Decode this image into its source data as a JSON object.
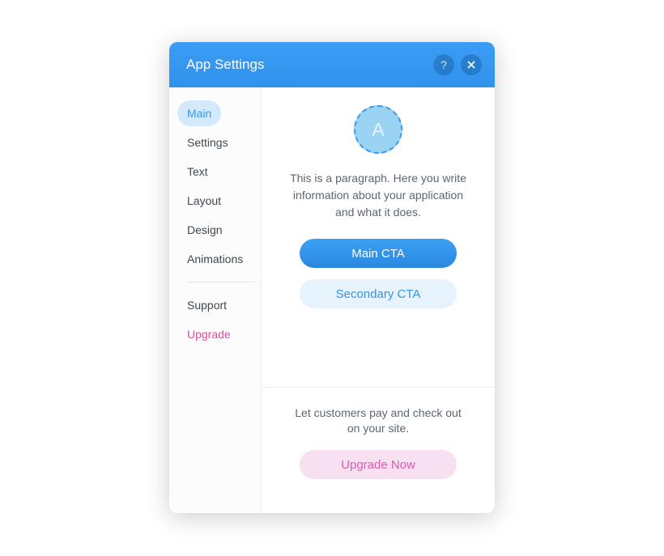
{
  "header": {
    "title": "App Settings",
    "help_label": "?",
    "close_label": "×"
  },
  "sidebar": {
    "items": [
      {
        "label": "Main"
      },
      {
        "label": "Settings"
      },
      {
        "label": "Text"
      },
      {
        "label": "Layout"
      },
      {
        "label": "Design"
      },
      {
        "label": "Animations"
      }
    ],
    "secondary": [
      {
        "label": "Support"
      },
      {
        "label": "Upgrade"
      }
    ]
  },
  "content": {
    "logo_letter": "A",
    "paragraph": "This is a paragraph. Here you write information about your application and what it does.",
    "primary_cta": "Main CTA",
    "secondary_cta": "Secondary CTA"
  },
  "footer": {
    "text": "Let customers pay and check out on your site.",
    "cta": "Upgrade Now"
  }
}
